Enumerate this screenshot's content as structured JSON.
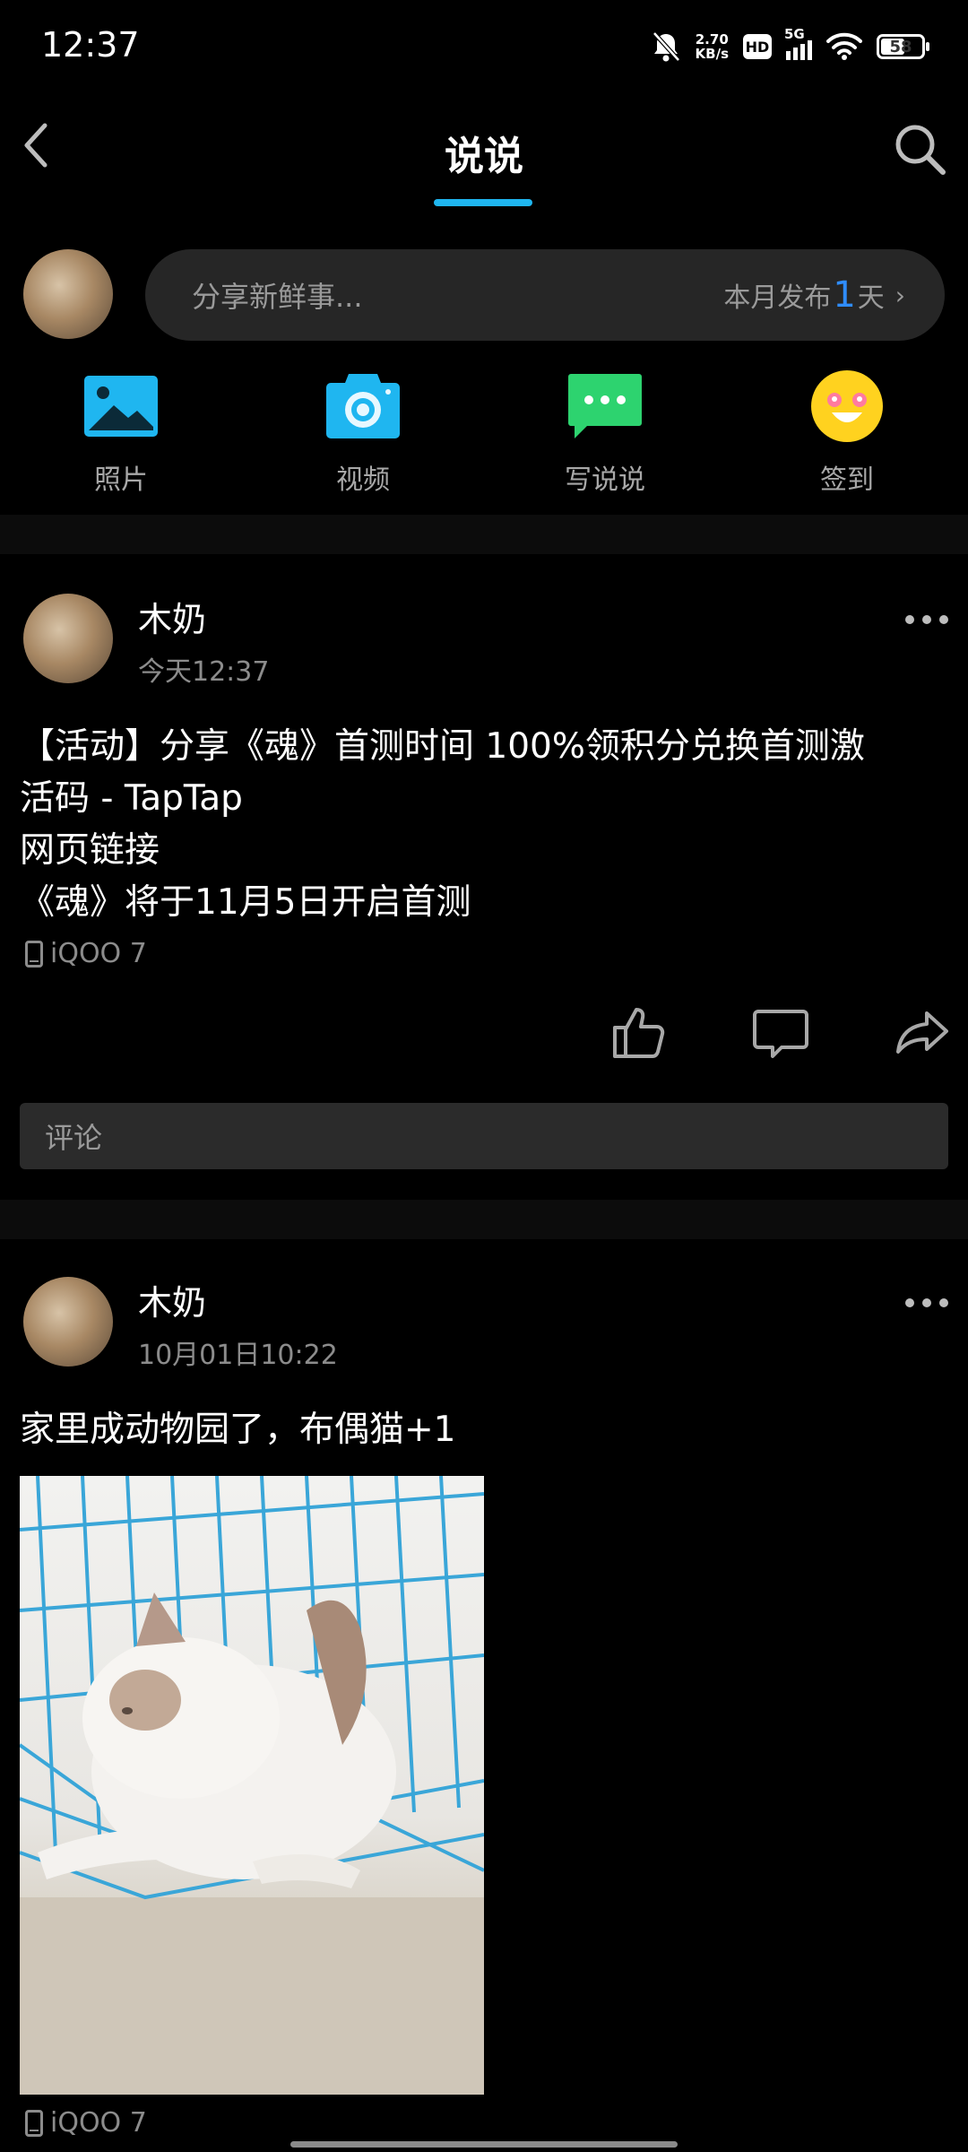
{
  "status_bar": {
    "time": "12:37",
    "net_speed_value": "2.70",
    "net_speed_unit": "KB/s",
    "hd_label": "HD",
    "network": "5G",
    "battery": "58"
  },
  "header": {
    "title": "说说",
    "back_icon": "back-arrow-icon",
    "search_icon": "search-icon",
    "accent_color": "#1fb6f0"
  },
  "composer": {
    "placeholder": "分享新鲜事...",
    "stat_prefix": "本月发布",
    "stat_number": "1",
    "stat_suffix": "天",
    "chevron": "›"
  },
  "quick_actions": [
    {
      "label": "照片",
      "icon": "photo-icon",
      "color": "#1fb6f0"
    },
    {
      "label": "视频",
      "icon": "camera-icon",
      "color": "#1fb6f0"
    },
    {
      "label": "写说说",
      "icon": "chat-icon",
      "color": "#2dd36f"
    },
    {
      "label": "签到",
      "icon": "smiley-icon",
      "color": "#ffd21f"
    }
  ],
  "posts": [
    {
      "author": "木奶",
      "time": "今天12:37",
      "lines": [
        "【活动】分享《魂》首测时间 100%领积分兑换首测激",
        "活码 - TapTap",
        "网页链接",
        "《魂》将于11月5日开启首测"
      ],
      "device": "iQOO 7",
      "comment_placeholder": "评论"
    },
    {
      "author": "木奶",
      "time": "10月01日10:22",
      "lines": [
        "家里成动物园了，布偶猫+1"
      ],
      "device": "iQOO 7"
    }
  ]
}
